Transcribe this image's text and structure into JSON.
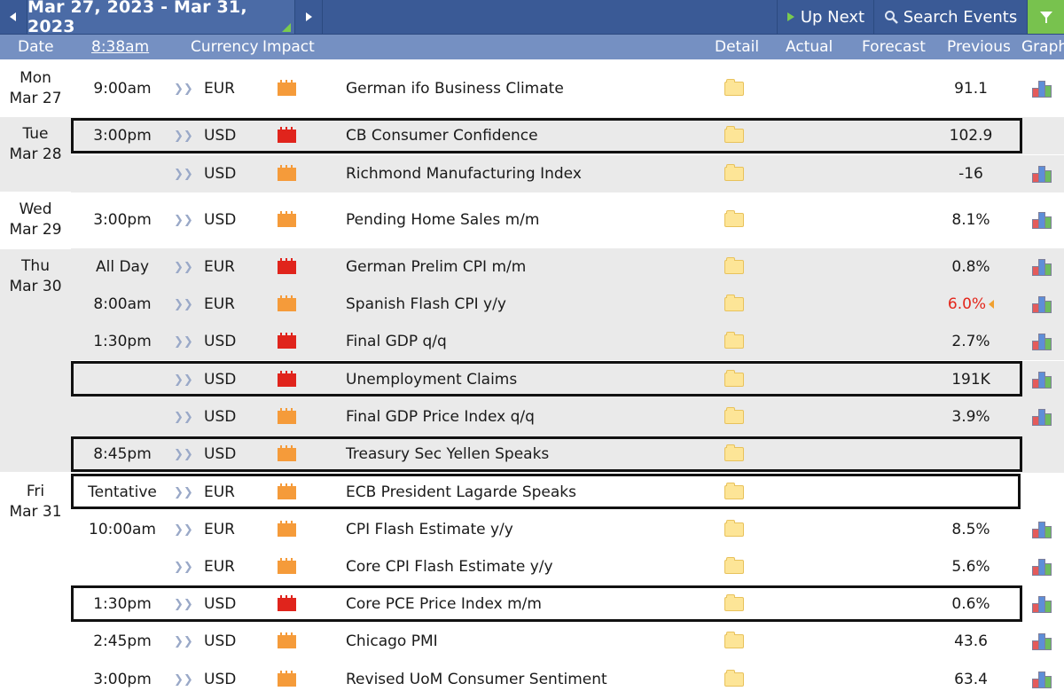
{
  "toolbar": {
    "prev_icon": "caret-left-icon",
    "date_range": "Mar 27, 2023 - Mar 31, 2023",
    "next_icon": "caret-right-icon",
    "up_next_label": "Up Next",
    "search_label": "Search Events",
    "filter_icon": "filter-funnel-icon"
  },
  "header": {
    "date": "Date",
    "time": "8:38am",
    "currency": "Currency",
    "impact": "Impact",
    "detail": "Detail",
    "actual": "Actual",
    "forecast": "Forecast",
    "previous": "Previous",
    "graph": "Graph"
  },
  "days": [
    {
      "weekday": "Mon",
      "date": "Mar 27"
    },
    {
      "weekday": "Tue",
      "date": "Mar 28"
    },
    {
      "weekday": "Wed",
      "date": "Mar 29"
    },
    {
      "weekday": "Thu",
      "date": "Mar 30"
    },
    {
      "weekday": "Fri",
      "date": "Mar 31"
    }
  ],
  "events": [
    {
      "time": "9:00am",
      "currency": "EUR",
      "impact": "medium",
      "event": "German ifo Business Climate",
      "previous": "91.1",
      "graph": true
    },
    {
      "time": "3:00pm",
      "currency": "USD",
      "impact": "high",
      "event": "CB Consumer Confidence",
      "previous": "102.9",
      "graph": false
    },
    {
      "time": "",
      "currency": "USD",
      "impact": "medium",
      "event": "Richmond Manufacturing Index",
      "previous": "-16",
      "graph": true
    },
    {
      "time": "3:00pm",
      "currency": "USD",
      "impact": "medium",
      "event": "Pending Home Sales m/m",
      "previous": "8.1%",
      "graph": true
    },
    {
      "time": "All Day",
      "currency": "EUR",
      "impact": "high",
      "event": "German Prelim CPI m/m",
      "previous": "0.8%",
      "graph": true
    },
    {
      "time": "8:00am",
      "currency": "EUR",
      "impact": "medium",
      "event": "Spanish Flash CPI y/y",
      "previous": "6.0%",
      "previous_revised": true,
      "graph": true
    },
    {
      "time": "1:30pm",
      "currency": "USD",
      "impact": "high",
      "event": "Final GDP q/q",
      "previous": "2.7%",
      "graph": true
    },
    {
      "time": "",
      "currency": "USD",
      "impact": "high",
      "event": "Unemployment Claims",
      "previous": "191K",
      "graph": true
    },
    {
      "time": "",
      "currency": "USD",
      "impact": "medium",
      "event": "Final GDP Price Index q/q",
      "previous": "3.9%",
      "graph": true
    },
    {
      "time": "8:45pm",
      "currency": "USD",
      "impact": "medium",
      "event": "Treasury Sec Yellen Speaks",
      "previous": "",
      "graph": false
    },
    {
      "time": "Tentative",
      "currency": "EUR",
      "impact": "medium",
      "event": "ECB President Lagarde Speaks",
      "previous": "",
      "graph": false
    },
    {
      "time": "10:00am",
      "currency": "EUR",
      "impact": "medium",
      "event": "CPI Flash Estimate y/y",
      "previous": "8.5%",
      "graph": true
    },
    {
      "time": "",
      "currency": "EUR",
      "impact": "medium",
      "event": "Core CPI Flash Estimate y/y",
      "previous": "5.6%",
      "graph": true
    },
    {
      "time": "1:30pm",
      "currency": "USD",
      "impact": "high",
      "event": "Core PCE Price Index m/m",
      "previous": "0.6%",
      "graph": true
    },
    {
      "time": "2:45pm",
      "currency": "USD",
      "impact": "medium",
      "event": "Chicago PMI",
      "previous": "43.6",
      "graph": true
    },
    {
      "time": "3:00pm",
      "currency": "USD",
      "impact": "medium",
      "event": "Revised UoM Consumer Sentiment",
      "previous": "63.4",
      "graph": true
    }
  ],
  "colors": {
    "impact_high": "#e0241c",
    "impact_medium": "#f59b3a",
    "revised_previous": "#e3261b"
  }
}
